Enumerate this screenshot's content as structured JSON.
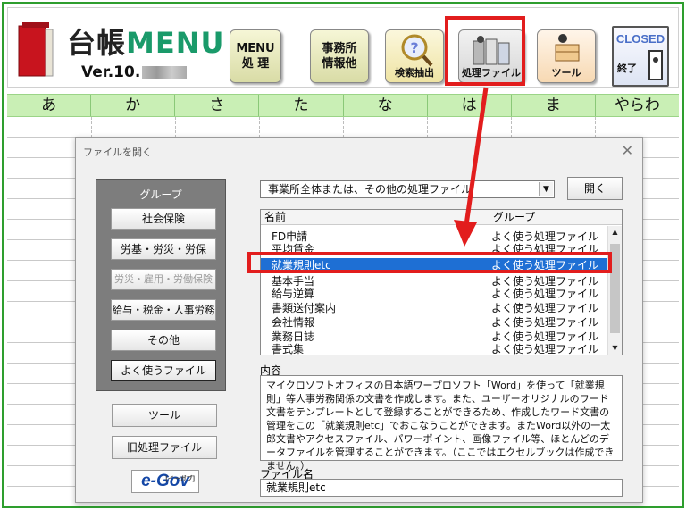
{
  "app": {
    "logo_text_kanji": "台帳",
    "logo_text_latin": "MENU",
    "version_prefix": "Ver.10."
  },
  "toolbar": {
    "menu_label_1": "MENU",
    "menu_label_2": "処 理",
    "office_label_1": "事務所",
    "office_label_2": "情報他",
    "search_label": "検索抽出",
    "process_label": "処理ファイル",
    "tool_label": "ツール",
    "closed_label": "CLOSED",
    "closed_sub": "終了"
  },
  "kana_bar": [
    "あ",
    "か",
    "さ",
    "た",
    "な",
    "は",
    "ま",
    "やらわ"
  ],
  "dialog": {
    "title": "ファイルを開く",
    "close": "✕",
    "group_panel_label": "グループ",
    "groups": [
      {
        "label": "社会保険",
        "state": "normal"
      },
      {
        "label": "労基・労災・労保",
        "state": "normal"
      },
      {
        "label": "労災・雇用・労働保険",
        "state": "disabled"
      },
      {
        "label": "給与・税金・人事労務",
        "state": "normal"
      },
      {
        "label": "その他",
        "state": "normal"
      },
      {
        "label": "よく使うファイル",
        "state": "selected"
      }
    ],
    "tool_button": "ツール",
    "old_files_button": "旧処理ファイル",
    "egov_logo": "e-Gov",
    "egov_kana": "[イーガブ]",
    "category_select": "事業所全体または、その他の処理ファイル",
    "open_button": "開く",
    "list_header_name": "名前",
    "list_header_group": "グループ",
    "rows": [
      {
        "name": "FD申請",
        "group": "よく使う処理ファイル"
      },
      {
        "name": "平均賃金",
        "group": "よく使う処理ファイル"
      },
      {
        "name": "就業規則etc",
        "group": "よく使う処理ファイル"
      },
      {
        "name": "基本手当",
        "group": "よく使う処理ファイル"
      },
      {
        "name": "給与逆算",
        "group": "よく使う処理ファイル"
      },
      {
        "name": "書類送付案内",
        "group": "よく使う処理ファイル"
      },
      {
        "name": "会社情報",
        "group": "よく使う処理ファイル"
      },
      {
        "name": "業務日誌",
        "group": "よく使う処理ファイル"
      },
      {
        "name": "書式集",
        "group": "よく使う処理ファイル"
      }
    ],
    "selected_index": 2,
    "content_label": "内容",
    "content_text": "マイクロソフトオフィスの日本語ワープロソフト「Word」を使って「就業規則」等人事労務関係の文書を作成します。また、ユーザーオリジナルのワード文書をテンプレートとして登録することができるため、作成したワード文書の管理をこの「就業規則etc」でおこなうことができます。またWord以外の一太郎文書やアクセスファイル、パワーポイント、画像ファイル等、ほとんどのデータファイルを管理することができます。（ここではエクセルブックは作成できません。）",
    "filename_label": "ファイル名",
    "filename_value": "就業規則etc"
  },
  "colors": {
    "frame_green": "#2e9e2e",
    "kana_bar": "#c9efb5",
    "selection_blue": "#1e6fd4",
    "annotation_red": "#e21d1d",
    "brand_green": "#1a9a6a"
  }
}
